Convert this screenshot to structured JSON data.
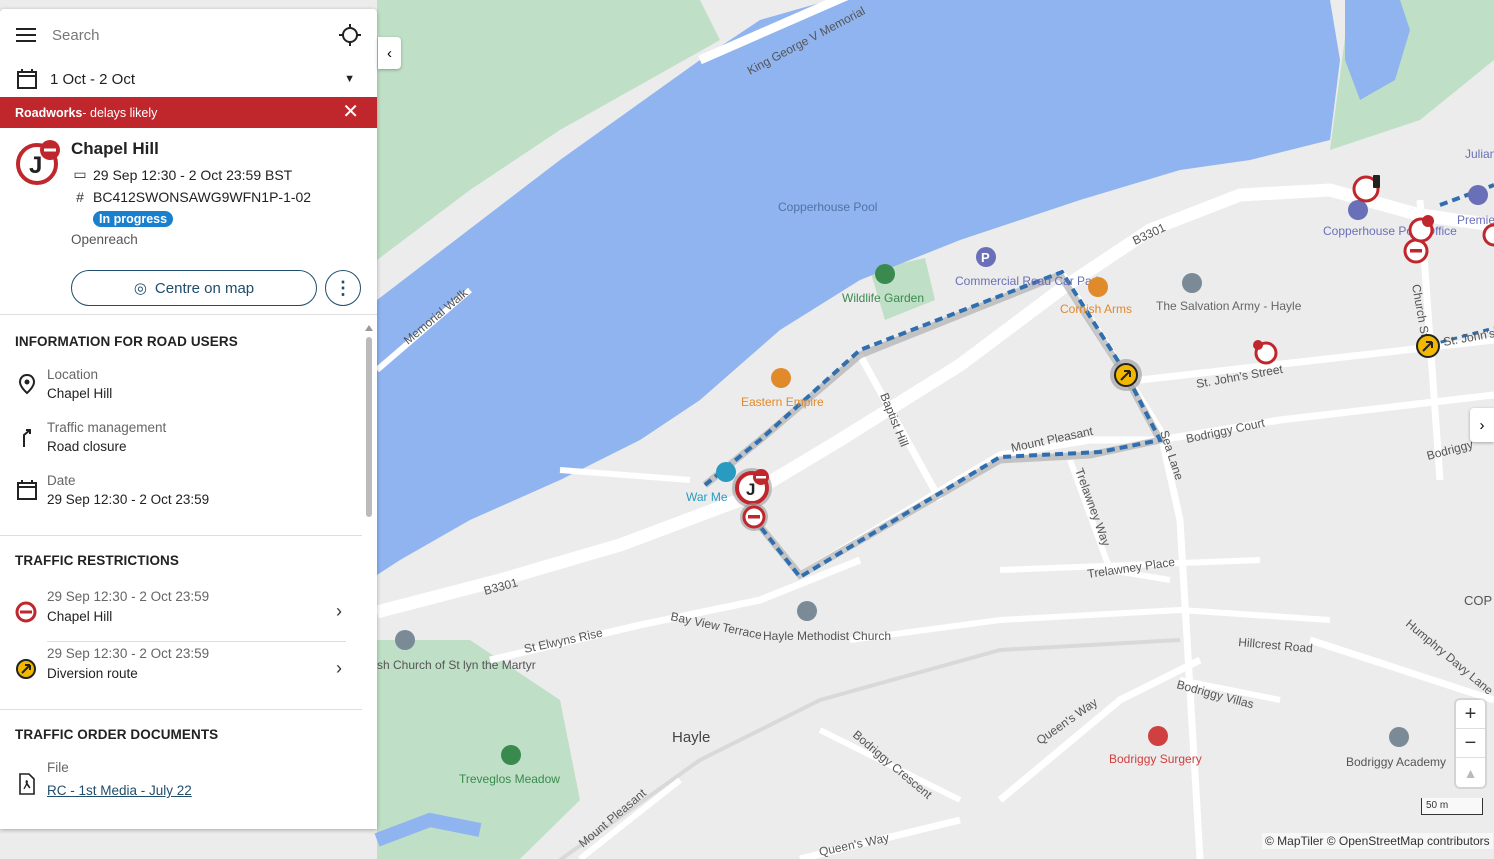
{
  "search": {
    "placeholder": "Search"
  },
  "date_filter": {
    "label": "1 Oct - 2 Oct"
  },
  "banner": {
    "category": "Roadworks",
    "suffix": " - delays likely"
  },
  "works": {
    "title": "Chapel Hill",
    "dates": "29 Sep 12:30 - 2 Oct 23:59 BST",
    "reference": "BC412SWONSAWG9WFN1P-1-02",
    "status": "In progress",
    "promoter": "Openreach",
    "centre_button": "Centre on map"
  },
  "info": {
    "heading": "INFORMATION FOR ROAD USERS",
    "location_label": "Location",
    "location_value": "Chapel Hill",
    "tm_label": "Traffic management",
    "tm_value": "Road closure",
    "date_label": "Date",
    "date_value": "29 Sep 12:30 - 2 Oct 23:59"
  },
  "restrictions": {
    "heading": "TRAFFIC RESTRICTIONS",
    "items": [
      {
        "dates": "29 Sep 12:30 - 2 Oct 23:59",
        "name": "Chapel Hill",
        "type": "road-closure"
      },
      {
        "dates": "29 Sep 12:30 - 2 Oct 23:59",
        "name": "Diversion route",
        "type": "diversion"
      }
    ]
  },
  "documents": {
    "heading": "TRAFFIC ORDER DOCUMENTS",
    "file_label": "File",
    "file_name": "RC - 1st Media - July 22"
  },
  "map": {
    "labels": {
      "copperhouse_pool": "Copperhouse Pool",
      "king_george": "King George V Memorial",
      "memorial_walk": "Memorial Walk",
      "b3301_top": "B3301",
      "b3301_left": "B3301",
      "wildlife_garden": "Wildlife Garden",
      "commercial_road": "Commercial Road Car Park",
      "cornish_arms": "Cornish Arms",
      "salvation_army": "The Salvation Army - Hayle",
      "copperhouse_po": "Copperhouse Post Office",
      "church_street": "Church Street",
      "st_johns_street": "St. John's Street",
      "st_johns_right": "St. John's",
      "eastern_empire": "Eastern Empire",
      "baptist_hill": "Baptist Hill",
      "mount_pleasant": "Mount Pleasant",
      "trelawney_way": "Trelawney Way",
      "sea_lane": "Sea Lane",
      "bodriggy_court": "Bodriggy Court",
      "bodriggy_right": "Bodriggy",
      "war_memorial": "War Me",
      "trelawney_place": "Trelawney Place",
      "bay_view_terrace": "Bay View Terrace",
      "st_elwyns": "St Elwyns Rise",
      "hayle_methodist": "Hayle Methodist Church",
      "church_of_st": "sh Church of St lyn the Martyr",
      "hillcrest": "Hillcrest Road",
      "humphry_davy": "Humphry Davy Lane",
      "bodriggy_villas": "Bodriggy Villas",
      "queens_way": "Queen's Way",
      "queens_way_bottom": "Queen's Way",
      "hayle": "Hayle",
      "bodriggy_crescent": "Bodriggy Crescent",
      "treveglos": "Treveglos Meadow",
      "mount_pleasant_bottom": "Mount Pleasant",
      "bodriggy_surgery": "Bodriggy Surgery",
      "bodriggy_academy": "Bodriggy Academy",
      "julian": "Julian Fu",
      "premier": "Premie",
      "cop": "COP"
    },
    "scale": "50 m",
    "attribution": "© MapTiler © OpenStreetMap contributors",
    "colors": {
      "water": "#8fb4ef",
      "park": "#bfe0c6",
      "land": "#ececec",
      "road": "#ffffff",
      "diversion": "#2f6fb0",
      "closure": "#c0272d",
      "diversion_icon": "#f2b800"
    }
  }
}
